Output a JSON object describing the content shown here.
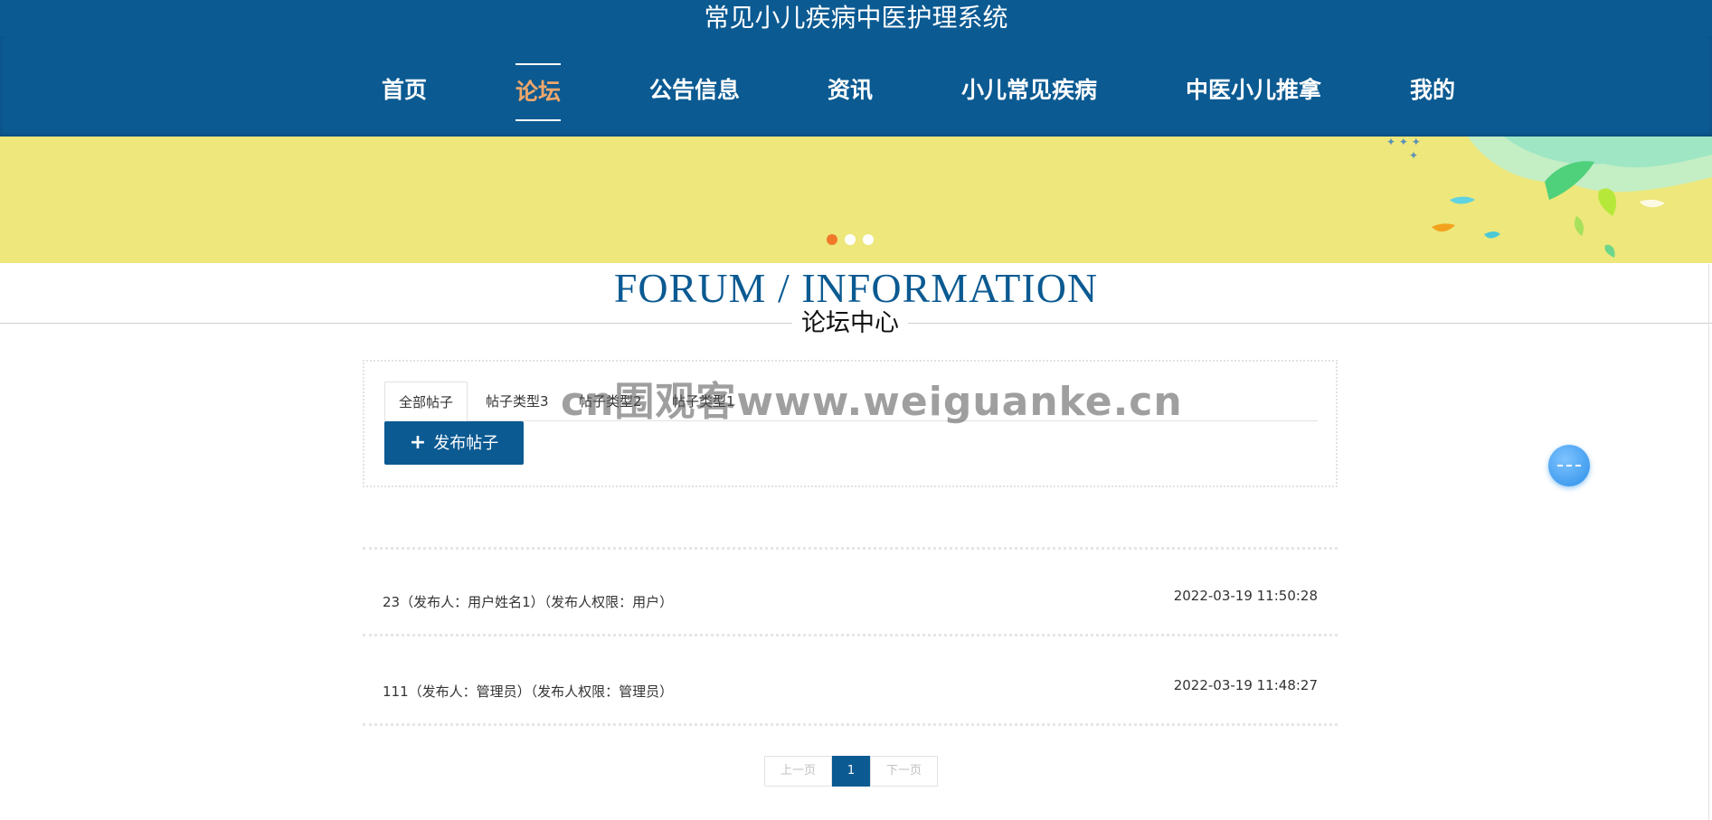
{
  "site": {
    "title": "常见小儿疾病中医护理系统"
  },
  "nav": {
    "items": [
      {
        "label": "首页"
      },
      {
        "label": "论坛"
      },
      {
        "label": "公告信息"
      },
      {
        "label": "资讯"
      },
      {
        "label": "小儿常见疾病"
      },
      {
        "label": "中医小儿推拿"
      },
      {
        "label": "我的"
      }
    ],
    "active_index": 1,
    "active_color": "#f0a76a"
  },
  "banner": {
    "background": "#ede77c",
    "dot_count": 3,
    "active_dot": 0
  },
  "section": {
    "heading_en": "FORUM / INFORMATION",
    "heading_cn": "论坛中心"
  },
  "filter": {
    "tabs": [
      {
        "label": "全部帖子"
      },
      {
        "label": "帖子类型3"
      },
      {
        "label": "帖子类型2"
      },
      {
        "label": "帖子类型1"
      }
    ],
    "publish_button": {
      "icon": "plus-icon",
      "label": "发布帖子"
    }
  },
  "watermark": "cn围观客www.weiguanke.cn",
  "posts": [
    {
      "title": "23（发布人：用户姓名1）（发布人权限：用户）",
      "time": "2022-03-19 11:50:28"
    },
    {
      "title": "111（发布人：管理员）（发布人权限：管理员）",
      "time": "2022-03-19 11:48:27"
    }
  ],
  "pagination": {
    "prev": "上一页",
    "current": "1",
    "next": "下一页"
  },
  "colors": {
    "primary": "#0b5a92",
    "banner": "#ede77c",
    "active_dot": "#f07a2a"
  }
}
